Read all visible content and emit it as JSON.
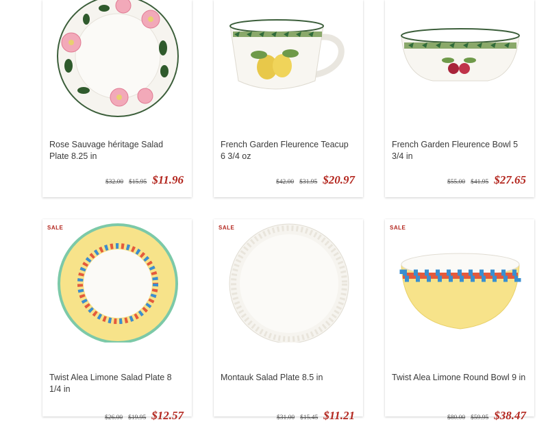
{
  "products": [
    {
      "sale": "",
      "title": "Rose Sauvage héritage Salad Plate 8.25 in",
      "orig": "$32.00",
      "was": "$15.95",
      "price": "$11.96"
    },
    {
      "sale": "",
      "title": "French Garden Fleurence Teacup 6 3/4 oz",
      "orig": "$42.00",
      "was": "$31.95",
      "price": "$20.97"
    },
    {
      "sale": "",
      "title": "French Garden Fleurence Bowl 5 3/4 in",
      "orig": "$55.00",
      "was": "$41.95",
      "price": "$27.65"
    },
    {
      "sale": "SALE",
      "title": "Twist Alea Limone Salad Plate 8 1/4 in",
      "orig": "$26.00",
      "was": "$19.95",
      "price": "$12.57"
    },
    {
      "sale": "SALE",
      "title": "Montauk Salad Plate 8.5 in",
      "orig": "$31.00",
      "was": "$15.45",
      "price": "$11.21"
    },
    {
      "sale": "SALE",
      "title": "Twist Alea Limone Round Bowl 9 in",
      "orig": "$80.00",
      "was": "$59.95",
      "price": "$38.47"
    }
  ]
}
